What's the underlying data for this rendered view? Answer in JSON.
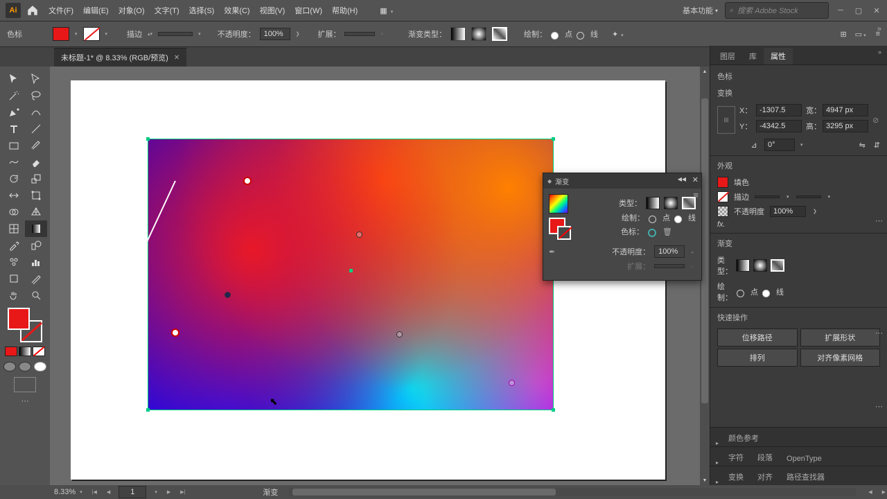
{
  "menu": {
    "file": "文件(F)",
    "edit": "编辑(E)",
    "object": "对象(O)",
    "text": "文字(T)",
    "select": "选择(S)",
    "effect": "效果(C)",
    "view": "视图(V)",
    "window": "窗口(W)",
    "help": "帮助(H)"
  },
  "workspace": "基本功能",
  "search_placeholder": "搜索 Adobe Stock",
  "ctrlbar": {
    "name": "色标",
    "stroke": "描边",
    "opacity": "不透明度：",
    "opacity_val": "100%",
    "expand": "扩展：",
    "gtype": "渐变类型：",
    "draw": "绘制：",
    "point": "点",
    "line": "线"
  },
  "doc_tab": "未标题-1* @ 8.33% (RGB/预览)",
  "right": {
    "tab_layers": "图层",
    "tab_lib": "库",
    "tab_props": "属性",
    "sec_selname": "色标",
    "transform": {
      "title": "变换",
      "x": "-1307.5",
      "y": "-4342.5",
      "w": "4947 px",
      "h": "3295 px",
      "xl": "X：",
      "yl": "Y：",
      "wl": "宽：",
      "hl": "高：",
      "ang": "0°"
    },
    "appearance": {
      "title": "外观",
      "fill": "填色",
      "stroke": "描边",
      "opacity": "不透明度",
      "opacity_val": "100%"
    },
    "gradient": {
      "title": "渐变",
      "type": "类型：",
      "draw": "绘制：",
      "point": "点",
      "line": "线"
    },
    "quick": {
      "title": "快速操作",
      "b1": "位移路径",
      "b2": "扩展形状",
      "b3": "排列",
      "b4": "对齐像素网格"
    },
    "colorguide": "颜色参考",
    "char": "字符",
    "para": "段落",
    "ot": "OpenType",
    "trans": "变换",
    "align": "对齐",
    "pathfind": "路径查找器"
  },
  "float": {
    "title": "渐变",
    "type": "类型：",
    "draw": "绘制：",
    "point": "点",
    "line": "线",
    "stop": "色标：",
    "opacity": "不透明度：",
    "opacity_val": "100%",
    "expand": "扩展："
  },
  "status": {
    "zoom": "8.33%",
    "nav": "1",
    "mode": "渐变"
  }
}
